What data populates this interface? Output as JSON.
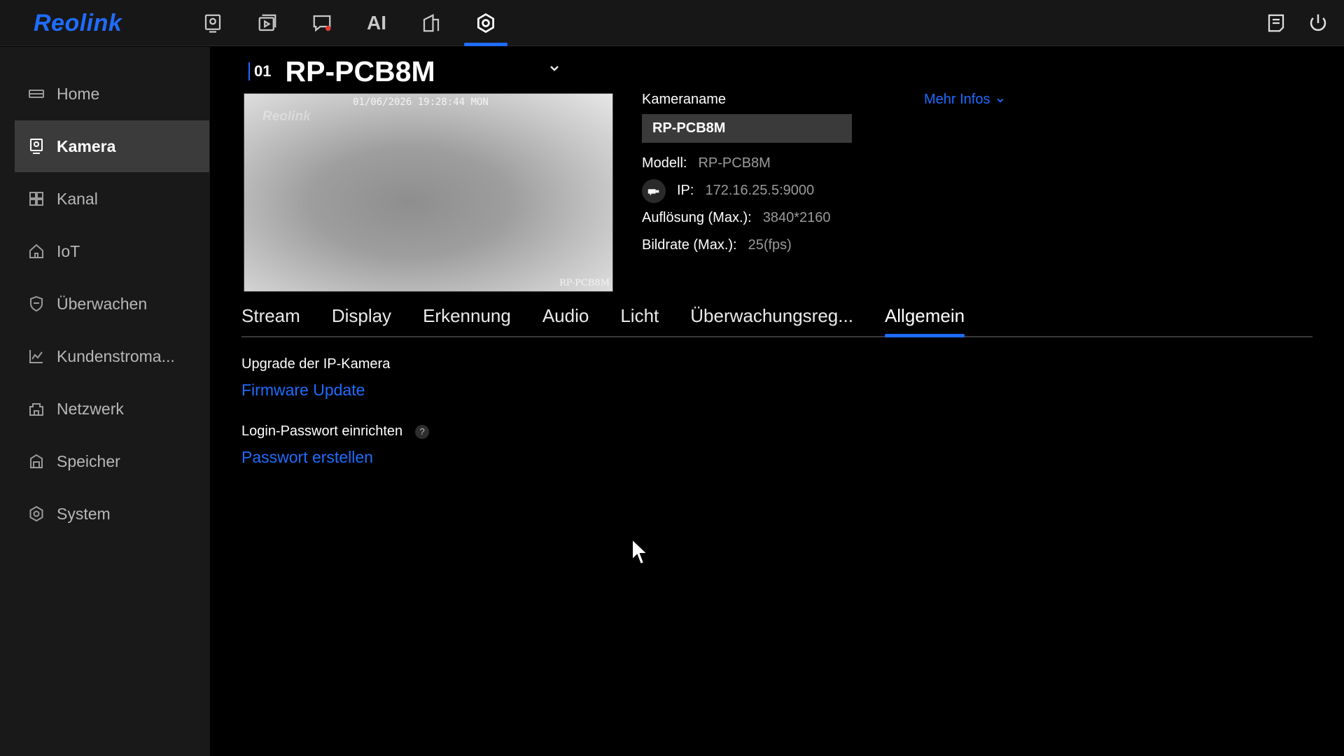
{
  "app": {
    "logo": "Reolink",
    "accent_color": "#1f6cff"
  },
  "topnav": {
    "items": [
      {
        "name": "preview",
        "icon": "camera-monitor-icon"
      },
      {
        "name": "playback",
        "icon": "playback-icon"
      },
      {
        "name": "alarm",
        "icon": "alarm-chat-icon"
      },
      {
        "name": "ai",
        "label": "AI"
      },
      {
        "name": "device",
        "icon": "device-icon"
      },
      {
        "name": "settings",
        "icon": "settings-icon",
        "active": true
      }
    ],
    "right": [
      {
        "name": "log",
        "icon": "log-icon"
      },
      {
        "name": "power",
        "icon": "power-icon"
      }
    ]
  },
  "sidebar": {
    "items": [
      {
        "label": "Home",
        "icon": "home-icon"
      },
      {
        "label": "Kamera",
        "icon": "camera-icon",
        "active": true
      },
      {
        "label": "Kanal",
        "icon": "grid-icon"
      },
      {
        "label": "IoT",
        "icon": "house-icon"
      },
      {
        "label": "Überwachen",
        "icon": "shield-icon"
      },
      {
        "label": "Kundenstroma...",
        "icon": "chart-icon"
      },
      {
        "label": "Netzwerk",
        "icon": "network-icon"
      },
      {
        "label": "Speicher",
        "icon": "storage-icon"
      },
      {
        "label": "System",
        "icon": "gear-icon"
      }
    ]
  },
  "camera": {
    "channel": "01",
    "title": "RP-PCB8M",
    "preview": {
      "osd_time": "01/06/2026 19:28:44 MON",
      "osd_logo": "Reolink",
      "osd_name": "RP-PCB8M"
    },
    "name_label": "Kameraname",
    "name_value": "RP-PCB8M",
    "more_info": "Mehr Infos",
    "model_label": "Modell:",
    "model_value": "RP-PCB8M",
    "ip_label": "IP:",
    "ip_value": "172.16.25.5:9000",
    "resolution_label": "Auflösung (Max.):",
    "resolution_value": "3840*2160",
    "framerate_label": "Bildrate (Max.):",
    "framerate_value": "25(fps)"
  },
  "tabs": [
    {
      "label": "Stream"
    },
    {
      "label": "Display"
    },
    {
      "label": "Erkennung"
    },
    {
      "label": "Audio"
    },
    {
      "label": "Licht"
    },
    {
      "label": "Überwachungsreg..."
    },
    {
      "label": "Allgemein",
      "active": true
    }
  ],
  "general": {
    "upgrade_label": "Upgrade der IP-Kamera",
    "upgrade_link": "Firmware Update",
    "password_label": "Login-Passwort einrichten",
    "password_help": "?",
    "password_link": "Passwort erstellen"
  }
}
